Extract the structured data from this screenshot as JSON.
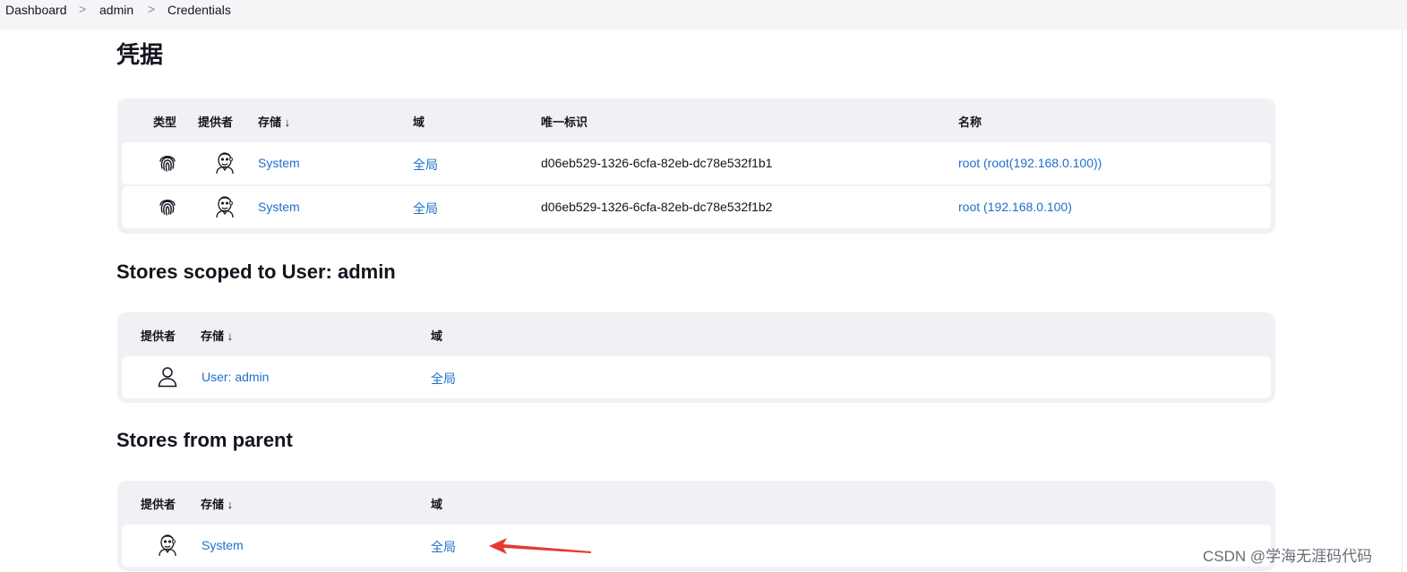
{
  "breadcrumb": {
    "items": [
      "Dashboard",
      "admin",
      "Credentials"
    ],
    "separator": ">"
  },
  "page_title": "凭据",
  "credentials_table": {
    "headers": {
      "type": "类型",
      "provider": "提供者",
      "store": "存储 ↓",
      "domain": "域",
      "id": "唯一标识",
      "name": "名称"
    },
    "rows": [
      {
        "type_icon": "fingerprint-icon",
        "provider_icon": "jenkins-butler-icon",
        "store": "System",
        "domain": "全局",
        "id": "d06eb529-1326-6cfa-82eb-dc78e532f1b1",
        "name": "root (root(192.168.0.100))"
      },
      {
        "type_icon": "fingerprint-icon",
        "provider_icon": "jenkins-butler-icon",
        "store": "System",
        "domain": "全局",
        "id": "d06eb529-1326-6cfa-82eb-dc78e532f1b2",
        "name": "root (192.168.0.100)"
      }
    ]
  },
  "user_stores": {
    "title": "Stores scoped to User: admin",
    "headers": {
      "provider": "提供者",
      "store": "存储 ↓",
      "domain": "域"
    },
    "rows": [
      {
        "provider_icon": "user-icon",
        "store": "User: admin",
        "domain": "全局"
      }
    ]
  },
  "parent_stores": {
    "title": "Stores from parent",
    "headers": {
      "provider": "提供者",
      "store": "存储 ↓",
      "domain": "域"
    },
    "rows": [
      {
        "provider_icon": "jenkins-butler-icon",
        "store": "System",
        "domain": "全局"
      }
    ]
  },
  "watermark": "CSDN @学海无涯码代码",
  "colors": {
    "link": "#1f6fcc",
    "panel": "#f1f1f5",
    "breadcrumb_bar": "#f5f5f8",
    "annotation_arrow": "#e53935"
  }
}
